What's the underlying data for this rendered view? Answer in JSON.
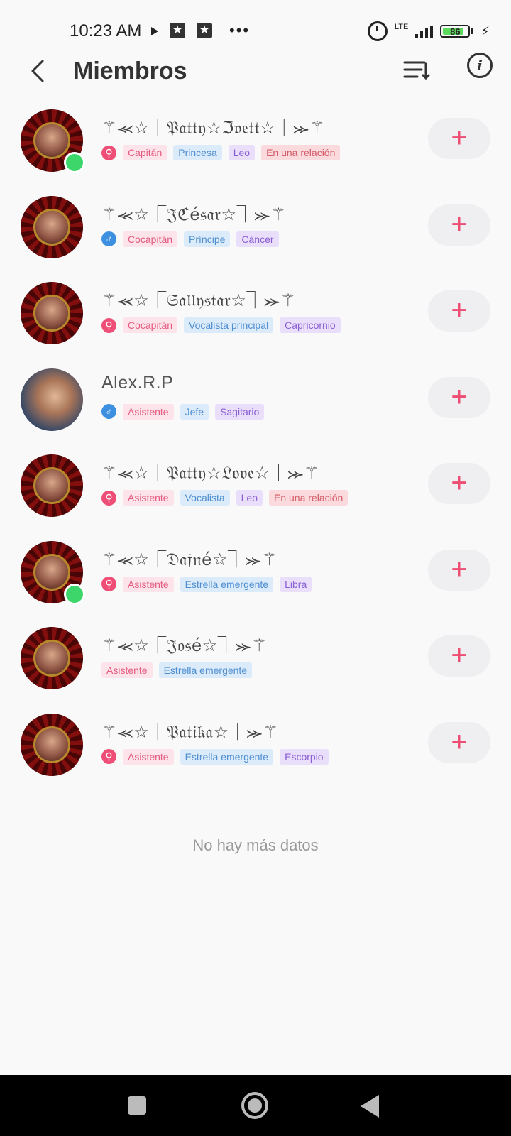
{
  "status_bar": {
    "time": "10:23 AM",
    "network": "LTE",
    "battery": "86",
    "battery_level": 0.86,
    "icons": [
      "play-icon",
      "star-notification-icon",
      "star-notification-icon",
      "more-dots-icon",
      "alarm-icon",
      "signal-icon",
      "battery-icon",
      "charging-icon"
    ]
  },
  "app_bar": {
    "title": "Miembros",
    "icons": [
      "back-arrow-icon",
      "sort-icon",
      "info-icon"
    ],
    "info_glyph": "i"
  },
  "colors": {
    "accent": "#ee4d74",
    "online": "#3dd66a",
    "female": "#ef4f77",
    "male": "#3d8fe0"
  },
  "members": [
    {
      "name": "⚚⪻☆⎾𝔓𝔞𝔱𝔱𝔶☆ℑ𝔳𝔢𝔱𝔱☆⏋⪼⚚",
      "online": true,
      "gender": "female",
      "gender_glyph": "⚲",
      "tags": [
        {
          "label": "Capitán",
          "color": "pink"
        },
        {
          "label": "Princesa",
          "color": "blue"
        },
        {
          "label": "Leo",
          "color": "purple"
        },
        {
          "label": "En una relación",
          "color": "red"
        }
      ],
      "add_label": "+"
    },
    {
      "name": "⚚⪻☆⎾𝔍ℭé𝔰𝔞𝔯☆⏋⪼⚚",
      "online": false,
      "gender": "male",
      "gender_glyph": "♂",
      "tags": [
        {
          "label": "Cocapitán",
          "color": "pink"
        },
        {
          "label": "Príncipe",
          "color": "blue"
        },
        {
          "label": "Cáncer",
          "color": "purple"
        }
      ],
      "add_label": "+"
    },
    {
      "name": "⚚⪻☆⎾𝔖𝔞𝔩𝔩𝔶𝔰𝔱𝔞𝔯☆⏋⪼⚚",
      "online": false,
      "gender": "female",
      "gender_glyph": "⚲",
      "tags": [
        {
          "label": "Cocapitán",
          "color": "pink"
        },
        {
          "label": "Vocalista principal",
          "color": "blue"
        },
        {
          "label": "Capricornio",
          "color": "purple"
        }
      ],
      "add_label": "+"
    },
    {
      "name": "Alex.R.P",
      "online": false,
      "gender": "male",
      "gender_glyph": "♂",
      "tags": [
        {
          "label": "Asistente",
          "color": "pink"
        },
        {
          "label": "Jefe",
          "color": "blue"
        },
        {
          "label": "Sagitario",
          "color": "purple"
        }
      ],
      "add_label": "+"
    },
    {
      "name": "⚚⪻☆⎾𝔓𝔞𝔱𝔱𝔶☆𝔏𝔬𝔳𝔢☆⏋⪼⚚",
      "online": false,
      "gender": "female",
      "gender_glyph": "⚲",
      "tags": [
        {
          "label": "Asistente",
          "color": "pink"
        },
        {
          "label": "Vocalista",
          "color": "blue"
        },
        {
          "label": "Leo",
          "color": "purple"
        },
        {
          "label": "En una relación",
          "color": "red"
        }
      ],
      "add_label": "+"
    },
    {
      "name": "⚚⪻☆⎾𝔇𝔞𝔣𝔫é☆⏋⪼⚚",
      "online": true,
      "gender": "female",
      "gender_glyph": "⚲",
      "tags": [
        {
          "label": "Asistente",
          "color": "pink"
        },
        {
          "label": "Estrella emergente",
          "color": "blue"
        },
        {
          "label": "Libra",
          "color": "purple"
        }
      ],
      "add_label": "+"
    },
    {
      "name": "⚚⪻☆⎾𝔍𝔬𝔰é☆⏋⪼⚚",
      "online": false,
      "gender": null,
      "gender_glyph": "",
      "tags": [
        {
          "label": "Asistente",
          "color": "pink"
        },
        {
          "label": "Estrella emergente",
          "color": "blue"
        }
      ],
      "add_label": "+"
    },
    {
      "name": "⚚⪻☆⎾𝔓𝔞𝔱𝔦𝔨𝔞☆⏋⪼⚚",
      "online": false,
      "gender": "female",
      "gender_glyph": "⚲",
      "tags": [
        {
          "label": "Asistente",
          "color": "pink"
        },
        {
          "label": "Estrella emergente",
          "color": "blue"
        },
        {
          "label": "Escorpio",
          "color": "purple"
        }
      ],
      "add_label": "+"
    }
  ],
  "footer_text": "No hay más datos",
  "nav_bar": {
    "icons": [
      "recents-square-icon",
      "home-circle-icon",
      "back-triangle-icon"
    ]
  }
}
